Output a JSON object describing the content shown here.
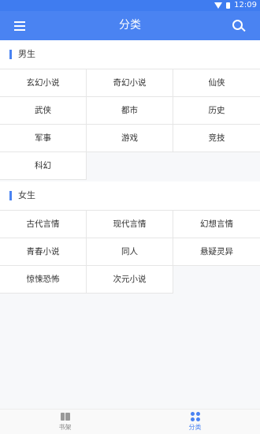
{
  "status_bar": {
    "time": "12:09"
  },
  "app_bar": {
    "title": "分类"
  },
  "sections": [
    {
      "title": "男生",
      "items": [
        "玄幻小说",
        "奇幻小说",
        "仙侠",
        "武侠",
        "都市",
        "历史",
        "军事",
        "游戏",
        "竞技",
        "科幻"
      ]
    },
    {
      "title": "女生",
      "items": [
        "古代言情",
        "现代言情",
        "幻想言情",
        "青春小说",
        "同人",
        "悬疑灵异",
        "惊悚恐怖",
        "次元小说"
      ]
    }
  ],
  "bottom_nav": {
    "bookshelf_label": "书架",
    "category_label": "分类"
  },
  "colors": {
    "accent": "#4a83f2",
    "status_bar": "#3f7cf0"
  }
}
